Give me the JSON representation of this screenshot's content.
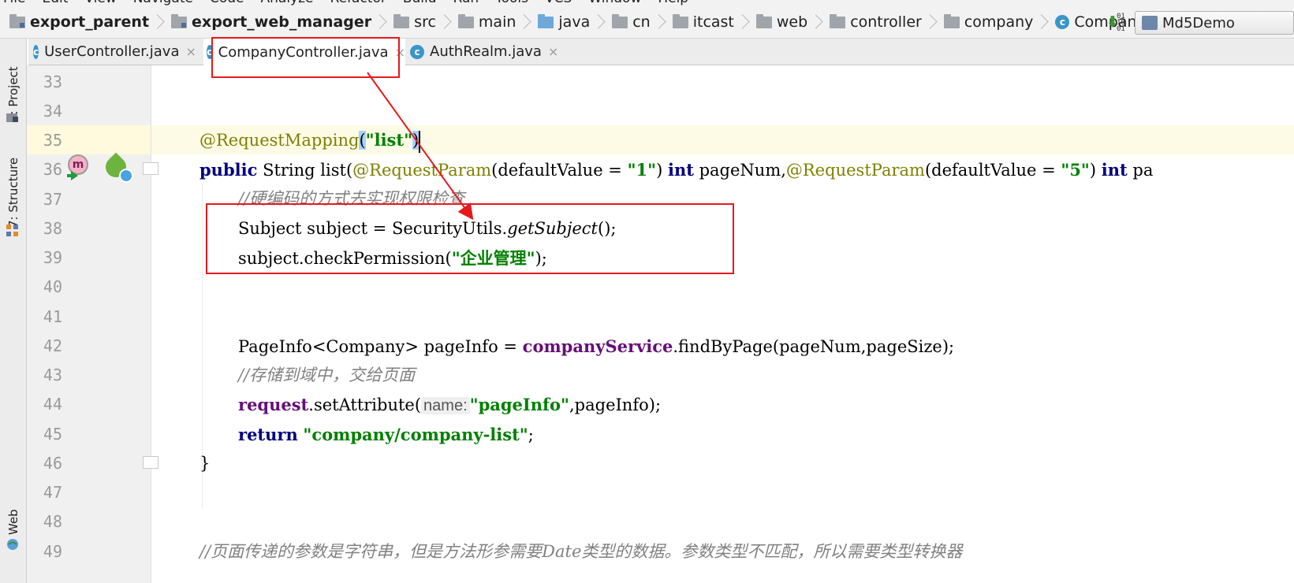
{
  "menu": [
    "File",
    "Edit",
    "View",
    "Navigate",
    "Code",
    "Analyze",
    "Refactor",
    "Build",
    "Run",
    "Tools",
    "VCS",
    "Window",
    "Help"
  ],
  "breadcrumbs": [
    {
      "label": "export_parent",
      "icon": "module-folder-icon",
      "bold": true
    },
    {
      "label": "export_web_manager",
      "icon": "module-folder-icon",
      "bold": true
    },
    {
      "label": "src",
      "icon": "folder-icon"
    },
    {
      "label": "main",
      "icon": "folder-icon"
    },
    {
      "label": "java",
      "icon": "source-folder-icon"
    },
    {
      "label": "cn",
      "icon": "package-icon"
    },
    {
      "label": "itcast",
      "icon": "package-icon"
    },
    {
      "label": "web",
      "icon": "package-icon"
    },
    {
      "label": "controller",
      "icon": "package-icon"
    },
    {
      "label": "company",
      "icon": "package-icon"
    },
    {
      "label": "CompanyController",
      "icon": "class-icon"
    }
  ],
  "sort_icon_bits": [
    "01",
    "10",
    "01"
  ],
  "run_config": "Md5Demo",
  "tabs": [
    {
      "label": "UserController.java",
      "close": "×"
    },
    {
      "label": "CompanyController.java",
      "close": "×"
    },
    {
      "label": "AuthRealm.java",
      "close": "×"
    }
  ],
  "class_icon_letter": "c",
  "method_marker_letter": "m",
  "sidebar": {
    "project": "1: Project",
    "structure": "7: Structure",
    "web": "Web"
  },
  "editor": {
    "active_line": 35,
    "lines": [
      {
        "n": "33"
      },
      {
        "n": "34"
      },
      {
        "n": "35"
      },
      {
        "n": "36"
      },
      {
        "n": "37"
      },
      {
        "n": "38"
      },
      {
        "n": "39"
      },
      {
        "n": "40"
      },
      {
        "n": "41"
      },
      {
        "n": "42"
      },
      {
        "n": "43"
      },
      {
        "n": "44"
      },
      {
        "n": "45"
      },
      {
        "n": "46"
      },
      {
        "n": "47"
      },
      {
        "n": "48"
      },
      {
        "n": "49"
      }
    ],
    "code": {
      "l35_ann": "@RequestMapping",
      "l35_paren_open": "(",
      "l35_str": "\"list\"",
      "l35_paren_close": ")",
      "l36_kw1": "public",
      "l36_a": " String list(",
      "l36_ann1": "@RequestParam",
      "l36_b": "(defaultValue = ",
      "l36_str1": "\"1\"",
      "l36_c": ") ",
      "l36_kw2": "int",
      "l36_d": " pageNum,",
      "l36_ann2": "@RequestParam",
      "l36_e": "(defaultValue = ",
      "l36_str2": "\"5\"",
      "l36_f": ") ",
      "l36_kw3": "int",
      "l36_g": " pa",
      "l37_cmt": "//硬编码的方式去实现权限检查",
      "l38_a": "Subject subject = SecurityUtils.",
      "l38_ital": "getSubject",
      "l38_b": "();",
      "l39_a": "subject.checkPermission(",
      "l39_str": "\"企业管理\"",
      "l39_b": ");",
      "l42_a": "PageInfo<Company> pageInfo = ",
      "l42_fld": "companyService",
      "l42_b": ".findByPage(pageNum,pageSize);",
      "l43_cmt": "//存储到域中，交给页面",
      "l44_fld": "request",
      "l44_a": ".setAttribute(",
      "l44_hint": "name:",
      "l44_str": "\"pageInfo\"",
      "l44_b": ",pageInfo);",
      "l45_kw": "return",
      "l45_sp": " ",
      "l45_str": "\"company/company-list\"",
      "l45_b": ";",
      "l46": "}",
      "l49_cmt": "//页面传递的参数是字符串，但是方法形参需要Date类型的数据。参数类型不匹配，所以需要类型转换器"
    }
  },
  "colors": {
    "highlight_box": "#e5191c",
    "arrow": "#e5191c",
    "keyword": "#000080",
    "annotation": "#808000",
    "string": "#008000",
    "comment": "#808080",
    "field": "#660e7a"
  }
}
